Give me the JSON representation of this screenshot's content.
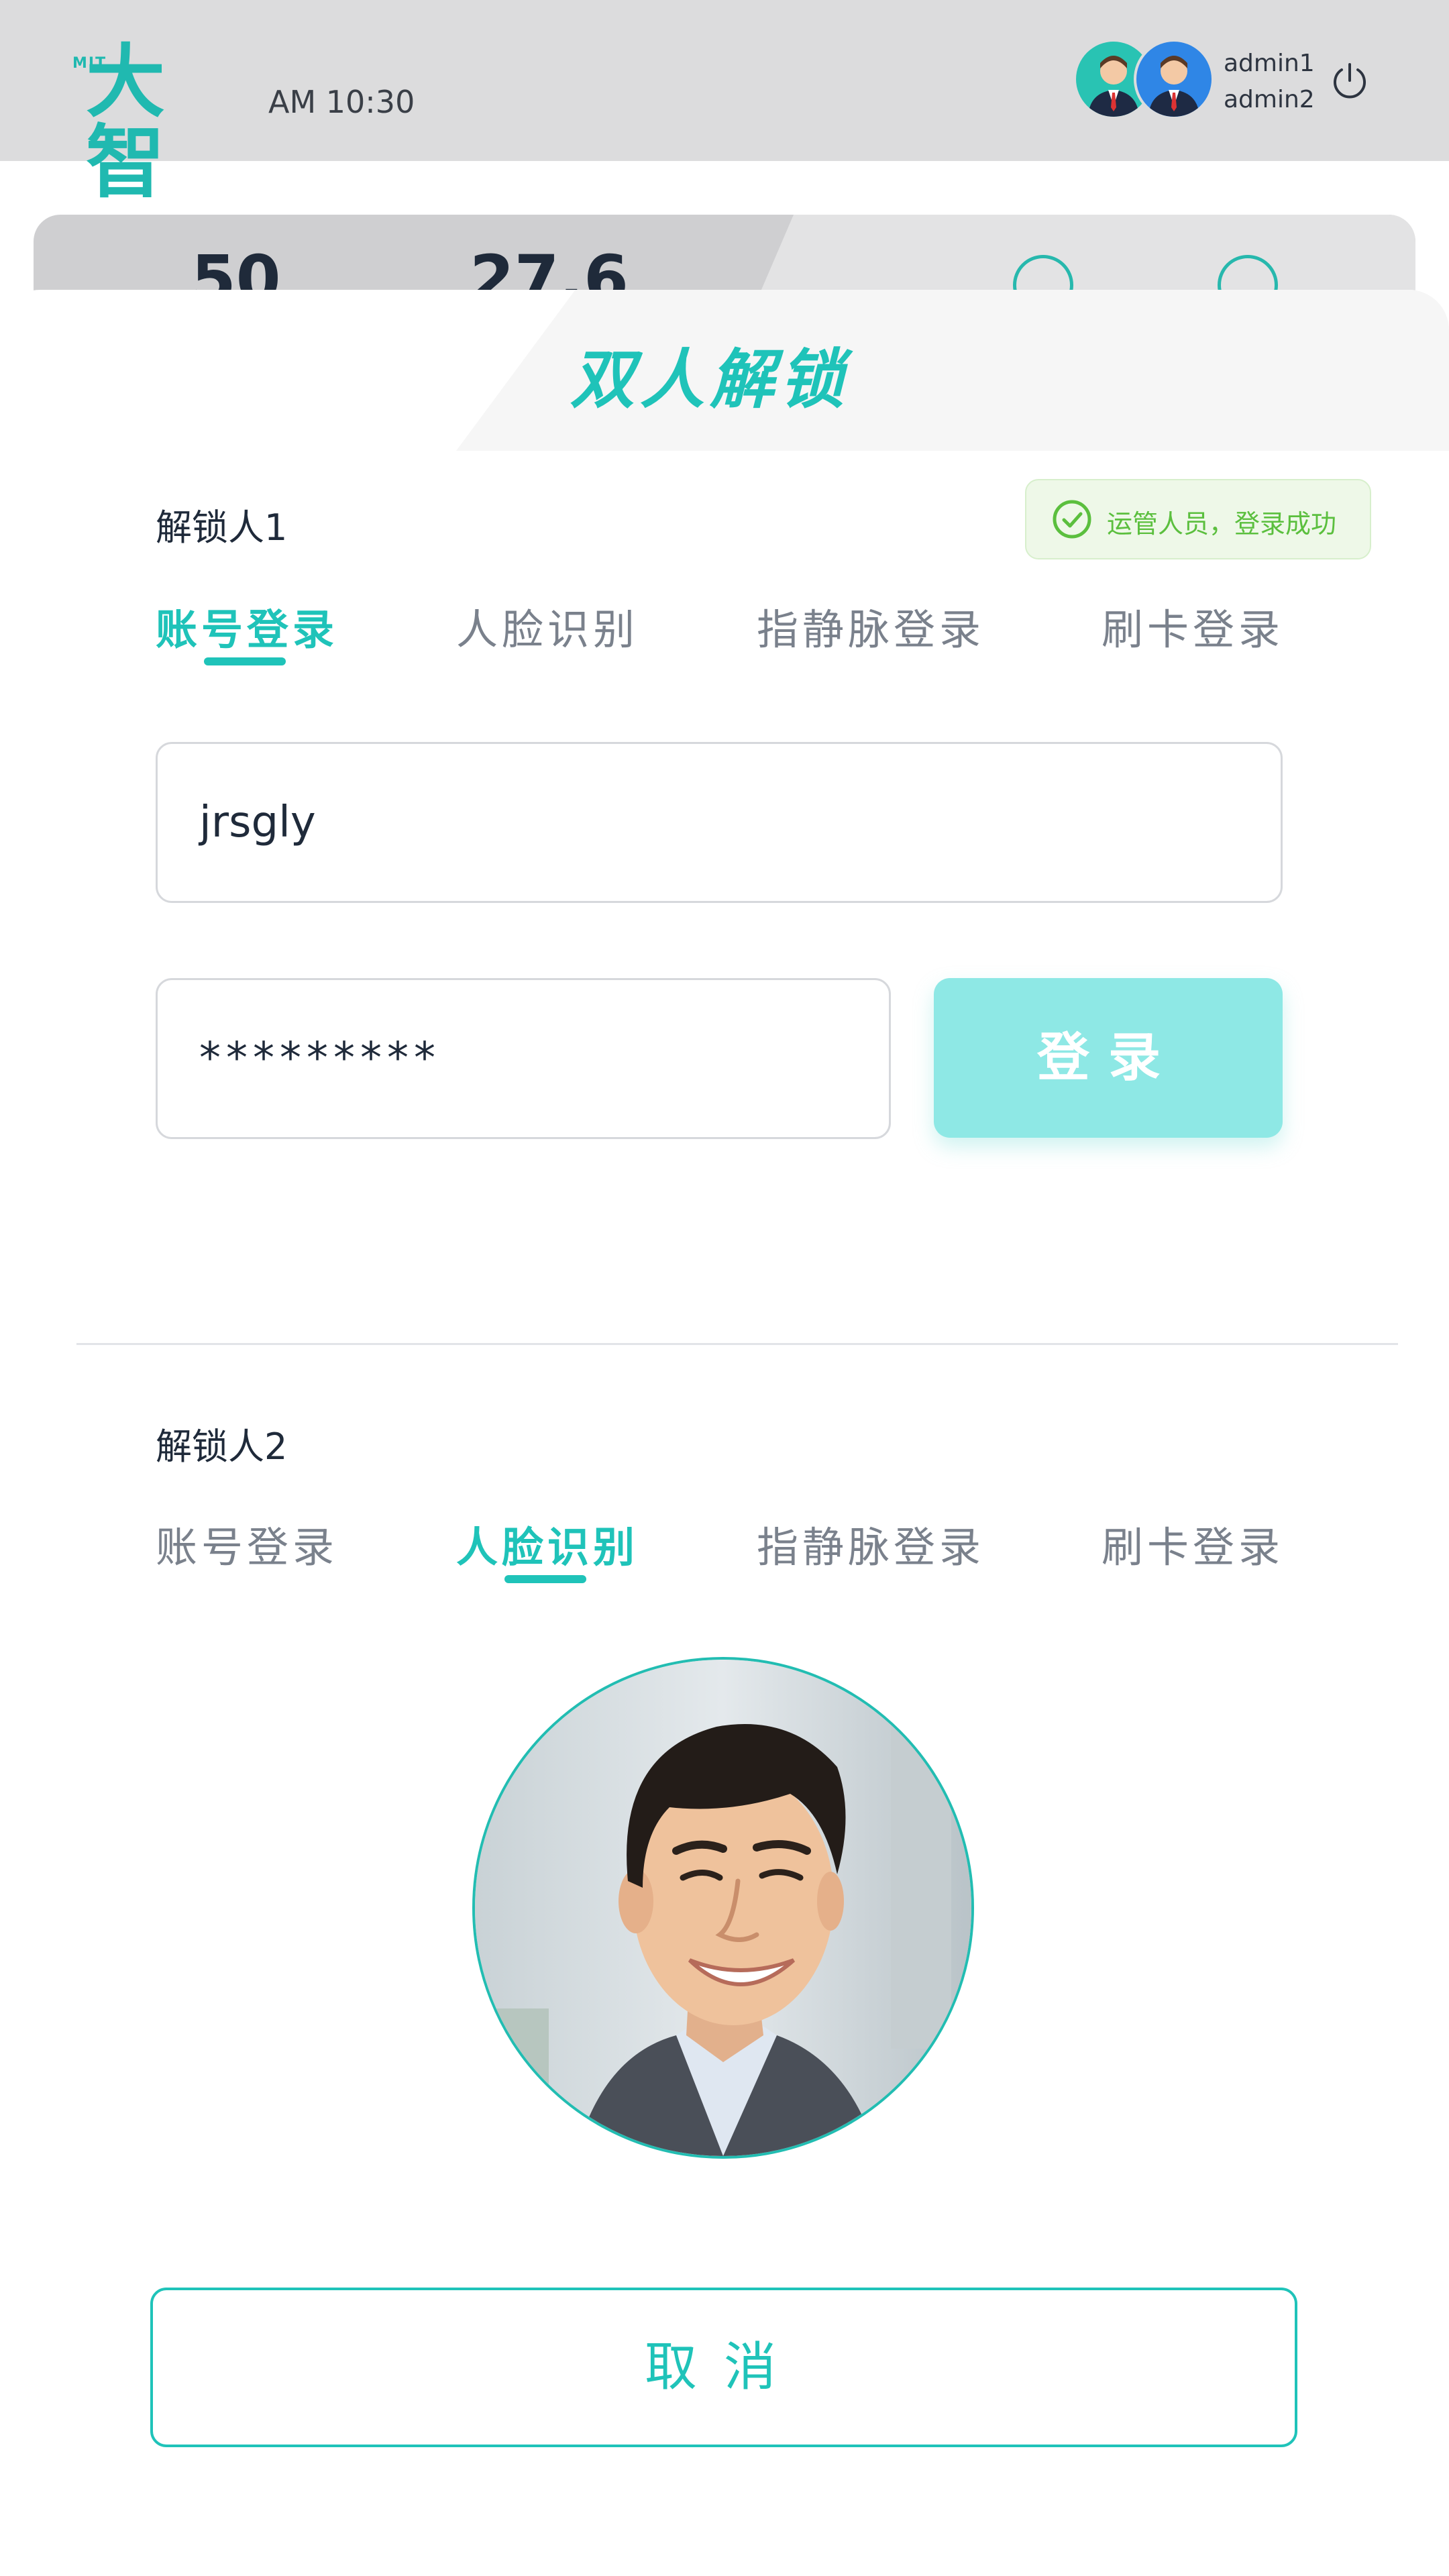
{
  "header": {
    "logo_mark": "MIT",
    "logo_text": "大智",
    "time": "AM 10:30",
    "users": [
      "admin1",
      "admin2"
    ]
  },
  "background": {
    "stat1": "50",
    "stat2": "27.6"
  },
  "dialog": {
    "title": "双人解锁",
    "unlocker1": {
      "label": "解锁人1",
      "status": "运管人员，登录成功",
      "tabs": [
        "账号登录",
        "人脸识别",
        "指静脉登录",
        "刷卡登录"
      ],
      "active_tab": "账号登录",
      "username": "jrsgly",
      "password": "*********",
      "login_label": "登录"
    },
    "unlocker2": {
      "label": "解锁人2",
      "tabs": [
        "账号登录",
        "人脸识别",
        "指静脉登录",
        "刷卡登录"
      ],
      "active_tab": "人脸识别"
    },
    "cancel_label": "取消"
  },
  "colors": {
    "accent": "#1fc3b9",
    "success": "#5bbf3e",
    "login_button": "#8ee8e5",
    "header_bg": "#dcdcdd"
  },
  "icons": [
    "user-avatar-icon",
    "power-icon",
    "check-circle-icon"
  ]
}
